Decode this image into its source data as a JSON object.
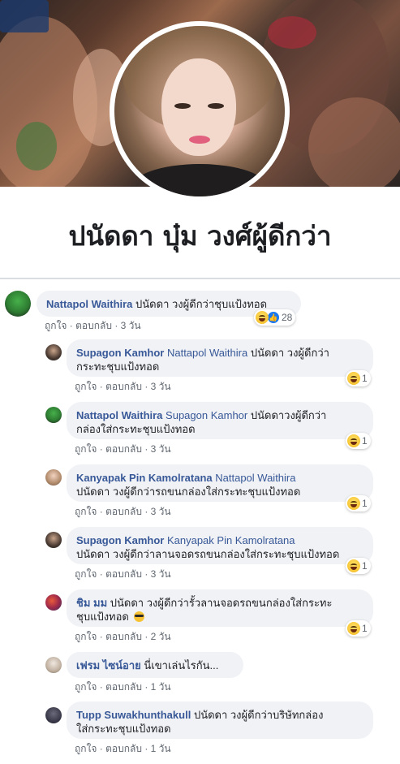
{
  "profile": {
    "name": "ปนัดดา บุ๋ม วงศ์ผู้ดีกว่า"
  },
  "actions": {
    "like": "ถูกใจ",
    "reply": "ตอบกลับ",
    "sep": "·"
  },
  "comments": [
    {
      "author": "Nattapol Waithira",
      "mention": "",
      "text": "ปนัดดา วงผู้ดีกว่าชุบแป้งทอด",
      "time": "3 วัน",
      "reaction_count": "28"
    },
    {
      "author": "Supagon Kamhor",
      "mention": "Nattapol Waithira",
      "text_line1": "ปนัดดา วงผู้ดีกว่า",
      "text_line2": "กระทะชุบแป้งทอด",
      "time": "3 วัน",
      "reaction_count": "1"
    },
    {
      "author": "Nattapol Waithira",
      "mention": "Supagon Kamhor",
      "text_line1": "ปนัดดาวงผู้ดีกว่า",
      "text_line2": "กล่องใส่กระทะชุบแป้งทอด",
      "time": "3 วัน",
      "reaction_count": "1"
    },
    {
      "author": "Kanyapak Pin Kamolratana",
      "mention": "Nattapol Waithira",
      "text_line2": "ปนัดดา วงผู้ดีกว่ารถขนกล่องใส่กระทะชุบแป้งทอด",
      "time": "3 วัน",
      "reaction_count": "1"
    },
    {
      "author": "Supagon Kamhor",
      "mention": "Kanyapak Pin Kamolratana",
      "text_line2": "ปนัดดา วงผู้ดีกว่าลานจอดรถขนกล่องใส่กระทะชุบแป้งทอด",
      "time": "3 วัน",
      "reaction_count": "1"
    },
    {
      "author": "ชิม มม",
      "text_line1": "ปนัดดา วงผู้ดีกว่ารั้วลานจอดรถขนกล่องใส่กระทะ",
      "text_line2": "ชุบแป้งทอด",
      "time": "2 วัน",
      "reaction_count": "1"
    },
    {
      "author": "เฟรม ไซน์อาย",
      "text": "นี่เขาเล่นไรกัน...",
      "time": "1 วัน"
    },
    {
      "author": "Tupp Suwakhunthakull",
      "text_line1": "ปนัดดา วงผู้ดีกว่าบริษัทกล่อง",
      "text_line2": "ใส่กระทะชุบแป้งทอด",
      "time": "1 วัน"
    }
  ],
  "colors": {
    "link": "#385898",
    "bubble": "#f0f2f5",
    "meta": "#606770"
  }
}
